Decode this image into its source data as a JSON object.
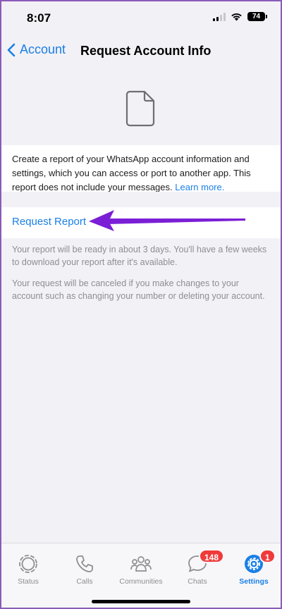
{
  "status_bar": {
    "time": "8:07",
    "battery": "74",
    "icons": [
      "signal-icon",
      "wifi-icon",
      "battery-icon"
    ]
  },
  "nav": {
    "back_label": "Account",
    "title": "Request Account Info"
  },
  "description": {
    "text": "Create a report of your WhatsApp account information and settings, which you can access or port to another app. This report does not include your messages. ",
    "link": "Learn more."
  },
  "request": {
    "label": "Request Report"
  },
  "notes": {
    "ready": "Your report will be ready in about 3 days. You'll have a few weeks to download your report after it's available.",
    "cancel": "Your request will be canceled if you make changes to your account such as changing your number or deleting your account."
  },
  "tabbar": {
    "tabs": [
      {
        "label": "Status",
        "icon": "status-icon"
      },
      {
        "label": "Calls",
        "icon": "phone-icon"
      },
      {
        "label": "Communities",
        "icon": "communities-icon"
      },
      {
        "label": "Chats",
        "icon": "chat-bubble-icon",
        "badge": "148"
      },
      {
        "label": "Settings",
        "icon": "gear-icon",
        "badge": "1"
      }
    ]
  },
  "colors": {
    "accent": "#1a7fe6",
    "badge": "#f03a3a",
    "annotation_arrow": "#7b1fd6",
    "background": "#f2f1f6"
  }
}
